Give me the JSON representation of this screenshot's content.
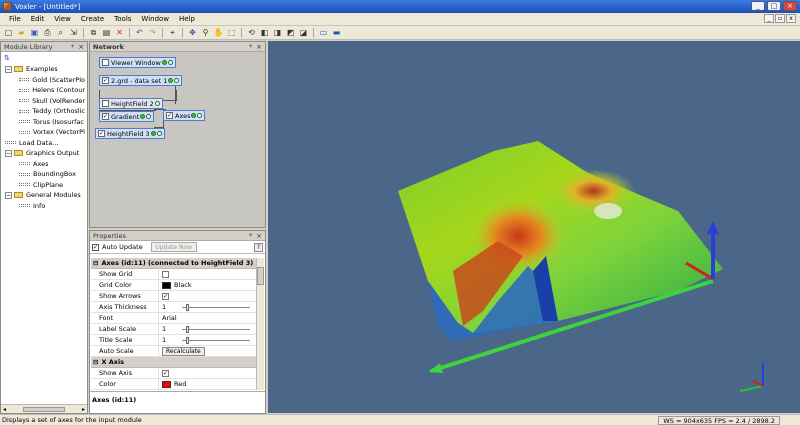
{
  "window": {
    "title": "Voxler - [Untitled*]",
    "minimize": "_",
    "maximize": "□",
    "close": "×"
  },
  "mdi": {
    "minimize": "_",
    "restore": "▫",
    "close": "x"
  },
  "menu": [
    "File",
    "Edit",
    "View",
    "Create",
    "Tools",
    "Window",
    "Help"
  ],
  "toolbar_icons": [
    "new-icon",
    "open-icon",
    "save-icon",
    "print-icon",
    "print-preview-icon",
    "export-icon",
    "copy-icon",
    "paste-icon",
    "delete-icon",
    "undo-icon",
    "redo-icon",
    "pointer-icon",
    "select-icon",
    "zoom-icon",
    "pan-icon",
    "fit-icon",
    "rotate-icon",
    "view-front-icon",
    "view-top-icon",
    "view-side-icon",
    "view-iso-icon",
    "camera-icon",
    "window-icon"
  ],
  "module_library": {
    "title": "Module Library",
    "pin": "📌",
    "close": "×",
    "tree": [
      {
        "label": "Examples",
        "type": "folder",
        "level": 0,
        "expander": "−"
      },
      {
        "label": "Gold (ScatterPlo",
        "type": "module",
        "level": 1
      },
      {
        "label": "Helens (Contour",
        "type": "module",
        "level": 1
      },
      {
        "label": "Skull (VolRender",
        "type": "module",
        "level": 1
      },
      {
        "label": "Teddy (Orthoslic",
        "type": "module",
        "level": 1
      },
      {
        "label": "Torus (Isosurfac",
        "type": "module",
        "level": 1
      },
      {
        "label": "Vortex (VectorPl",
        "type": "module",
        "level": 1
      },
      {
        "label": "Load Data...",
        "type": "module",
        "level": 0
      },
      {
        "label": "Graphics Output",
        "type": "folder",
        "level": 0,
        "expander": "−"
      },
      {
        "label": "Axes",
        "type": "module",
        "level": 1
      },
      {
        "label": "BoundingBox",
        "type": "module",
        "level": 1
      },
      {
        "label": "ClipPlane",
        "type": "module",
        "level": 1
      },
      {
        "label": "General Modules",
        "type": "folder",
        "level": 0,
        "expander": "−"
      },
      {
        "label": "Info",
        "type": "module",
        "level": 1
      }
    ]
  },
  "network": {
    "title": "Network",
    "nodes": [
      {
        "id": "viewer",
        "label": "Viewer Window"
      },
      {
        "id": "data",
        "label": "2.grd - data set 1"
      },
      {
        "id": "hf2",
        "label": "HeightField 2"
      },
      {
        "id": "gradient",
        "label": "Gradient"
      },
      {
        "id": "axes",
        "label": "Axes"
      },
      {
        "id": "hf3",
        "label": "HeightField 3"
      }
    ]
  },
  "properties": {
    "title": "Properties",
    "auto_update": "Auto Update",
    "update_now": "Update Now",
    "help": "?",
    "section_title": "Axes (id:11) (connected to HeightField 3)",
    "rows": [
      {
        "key": "Show Grid",
        "kind": "check",
        "checked": ""
      },
      {
        "key": "Grid Color",
        "kind": "color",
        "value": "Black",
        "color": "#000000"
      },
      {
        "key": "Show Arrows",
        "kind": "check",
        "checked": "✓"
      },
      {
        "key": "Axis Thickness",
        "kind": "slider",
        "value": "1"
      },
      {
        "key": "Font",
        "kind": "text",
        "value": "Arial"
      },
      {
        "key": "Label Scale",
        "kind": "slider",
        "value": "1"
      },
      {
        "key": "Title Scale",
        "kind": "slider",
        "value": "1"
      },
      {
        "key": "Auto Scale",
        "kind": "button",
        "value": "Recalculate"
      }
    ],
    "subsection": "X Axis",
    "rows2": [
      {
        "key": "Show Axis",
        "kind": "check",
        "checked": "✓"
      },
      {
        "key": "Color",
        "kind": "color",
        "value": "Red",
        "color": "#ff0000"
      }
    ],
    "footer": "Axes (id:11)"
  },
  "status": {
    "left": "Displays a set of axes for the input module",
    "right": "WS = 904x635  FPS = 2.4 / 2898.2"
  }
}
